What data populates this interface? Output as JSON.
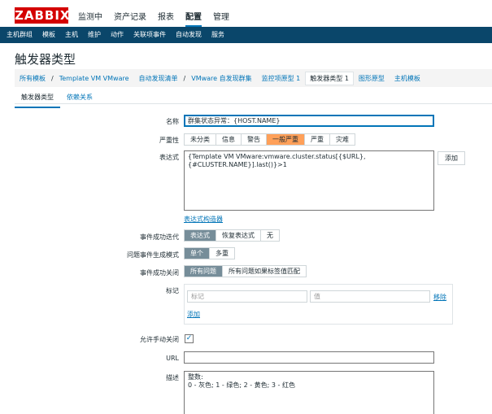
{
  "header": {
    "logo": "ZABBIX",
    "nav": [
      "监测中",
      "资产记录",
      "报表",
      "配置",
      "管理"
    ],
    "active_nav": "配置"
  },
  "menubar": [
    "主机群组",
    "模板",
    "主机",
    "维护",
    "动作",
    "关联项事件",
    "自动发现",
    "服务"
  ],
  "page_title": "触发器类型",
  "breadcrumb": {
    "all_templates": "所有模板",
    "sep": "/",
    "template": "Template VM VMware",
    "discovery_list": "自动发现清单",
    "discovery_rule": "VMware 自发现群集",
    "item_prototypes": "监控项原型 1",
    "trigger_prototypes": "触发器类型 1",
    "graph_prototypes": "图形原型",
    "host_prototypes": "主机模板"
  },
  "tabs": {
    "trigger": "触发器类型",
    "deps": "依赖关系"
  },
  "form": {
    "name_label": "名称",
    "name_value": "群集状态异常：{HOST.NAME}",
    "severity_label": "严重性",
    "severity_options": [
      "未分类",
      "信息",
      "警告",
      "一般严重",
      "严重",
      "灾难"
    ],
    "severity_selected": "一般严重",
    "expr_label": "表达式",
    "expr_line1": "{Template VM VMware:vmware.cluster.status[{$URL},",
    "expr_line2": "{#CLUSTER.NAME}].last()}>1",
    "add_button": "添加",
    "expr_builder": "表达式构造器",
    "ok_event_label": "事件成功迭代",
    "ok_event_options": [
      "表达式",
      "恢复表达式",
      "无"
    ],
    "ok_event_selected": "表达式",
    "problem_mode_label": "问题事件生成模式",
    "problem_mode_options": [
      "单个",
      "多重"
    ],
    "problem_mode_selected": "单个",
    "ok_close_label": "事件成功关闭",
    "ok_close_options": [
      "所有问题",
      "所有问题如果标签值匹配"
    ],
    "ok_close_selected": "所有问题",
    "tags_label": "标记",
    "tag_placeholder": "标记",
    "value_placeholder": "值",
    "remove_link": "移除",
    "add_link": "添加",
    "manual_close_label": "允许手动关闭",
    "manual_close_checked": "✓",
    "url_label": "URL",
    "url_value": "",
    "desc_label": "描述",
    "desc_line1": "整数:",
    "desc_line2": "0 - 灰色; 1 - 绿色; 2 - 黄色; 3 - 红色"
  }
}
